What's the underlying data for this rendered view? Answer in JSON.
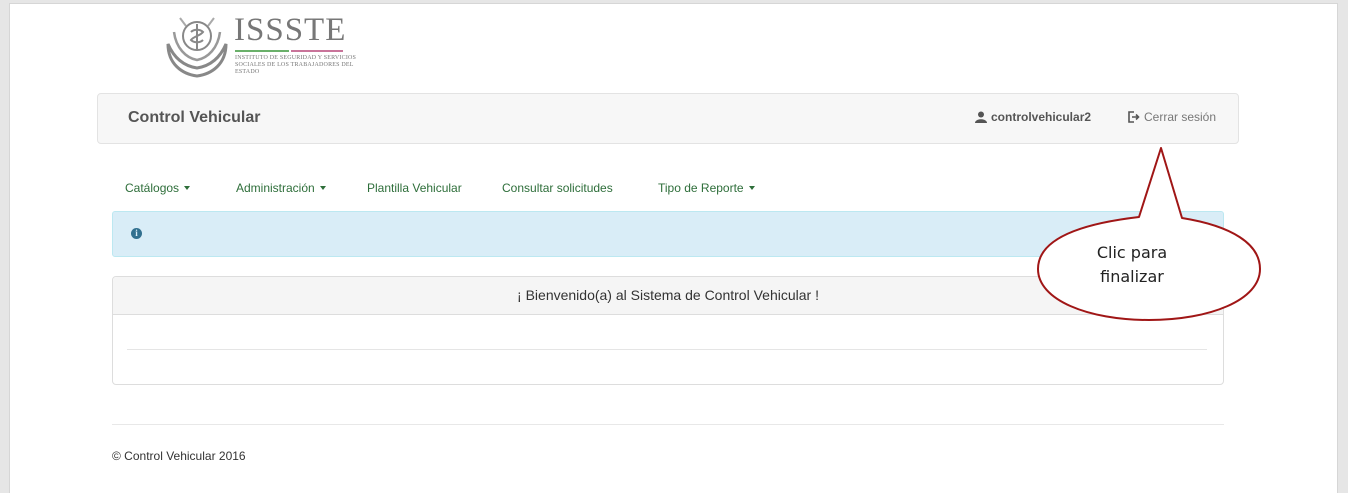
{
  "logo": {
    "title": "ISSSTE",
    "subtitle": "Instituto de Seguridad y Servicios Sociales de los Trabajadores del Estado"
  },
  "navbar": {
    "brand": "Control Vehicular",
    "user_icon": "user-icon",
    "username": "controlvehicular2",
    "logout_icon": "logout-icon",
    "logout_label": "Cerrar sesión"
  },
  "menu": {
    "catalogos": "Catálogos",
    "administracion": "Administración",
    "plantilla": "Plantilla Vehicular",
    "consultar": "Consultar solicitudes",
    "tipo_reporte": "Tipo de Reporte"
  },
  "alert": {
    "icon": "info-icon",
    "color": "#d9edf7"
  },
  "panel": {
    "heading": "¡ Bienvenido(a) al Sistema de Control Vehicular !"
  },
  "footer": {
    "text": "© Control Vehicular 2016"
  },
  "callout": {
    "text": "Clic para finalizar",
    "border_color": "#a01616"
  },
  "colors": {
    "menu_link": "#2e6e3a",
    "navbar_bg": "#f7f7f7"
  }
}
